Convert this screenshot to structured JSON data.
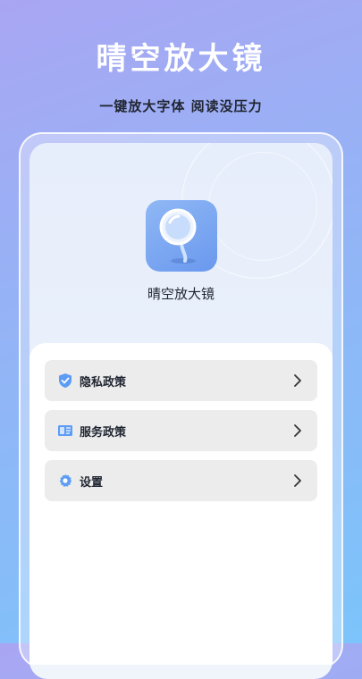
{
  "hero": {
    "title": "晴空放大镜",
    "subtitle": "一键放大字体  阅读没压力"
  },
  "app": {
    "icon": "magnifier-icon",
    "name": "晴空放大镜"
  },
  "menu": {
    "items": [
      {
        "label": "隐私政策",
        "icon": "shield-check-icon"
      },
      {
        "label": "服务政策",
        "icon": "document-icon"
      },
      {
        "label": "设置",
        "icon": "gear-icon"
      }
    ]
  },
  "colors": {
    "accent": "#4a8df0",
    "background_top": "#a9a6f3",
    "background_bottom": "#7cc4fb"
  }
}
